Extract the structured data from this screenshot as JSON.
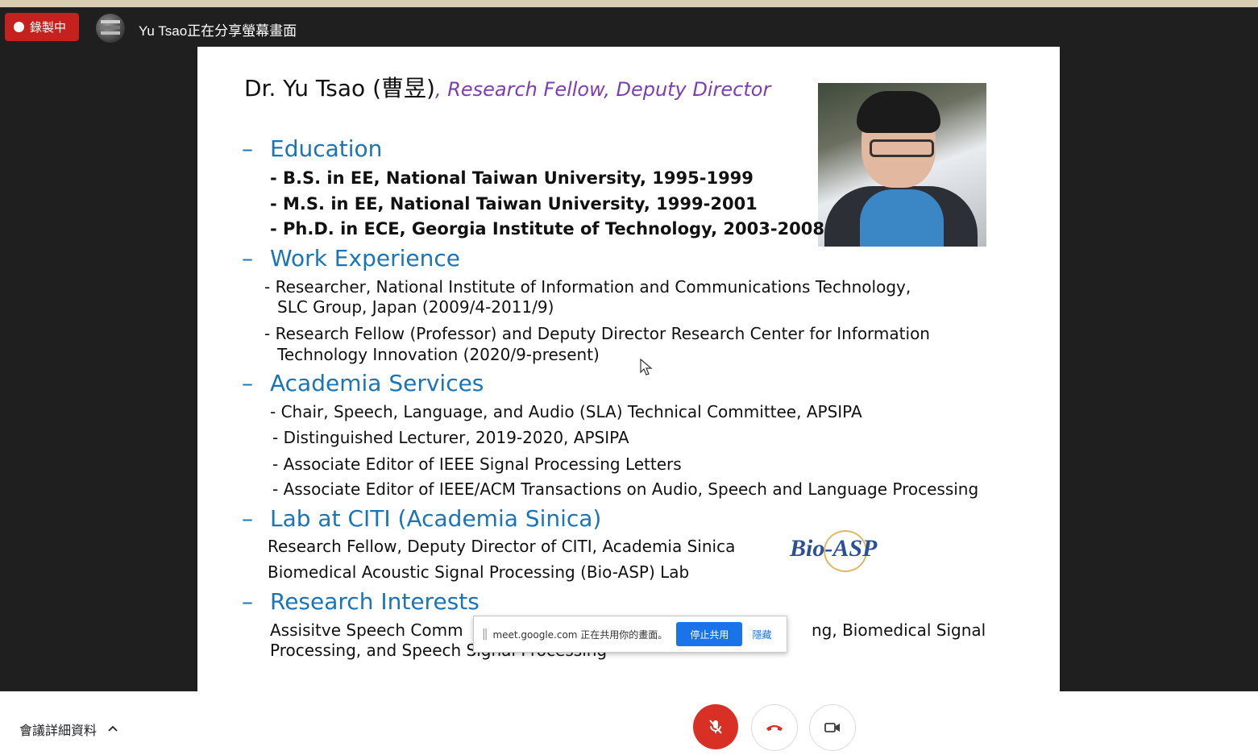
{
  "colors": {
    "recording": "#c5221f",
    "heading": "#1a74b8",
    "subtitle": "#7b3fb0",
    "stop_button": "#1a73e8",
    "mic_off": "#d93025"
  },
  "top_bar": {
    "recording_label": "錄製中",
    "presenter_text": "Yu Tsao正在分享螢幕畫面"
  },
  "slide": {
    "title": "Dr. Yu Tsao (曹昱)",
    "subtitle": ", Research Fellow, Deputy Director",
    "dash": "–",
    "education": {
      "heading": "Education",
      "items": [
        "- B.S.   in EE, National Taiwan University, 1995-1999",
        "- M.S.  in EE, National Taiwan University, 1999-2001",
        "- Ph.D. in ECE, Georgia Institute of Technology, 2003-2008"
      ]
    },
    "work": {
      "heading": "Work Experience",
      "items": [
        "- Researcher, National Institute of Information and Communications Technology,",
        "SLC Group, Japan (2009/4-2011/9)",
        "- Research Fellow (Professor) and Deputy Director Research Center for Information",
        "Technology Innovation (2020/9-present)"
      ]
    },
    "academia": {
      "heading": "Academia Services",
      "items": [
        "- Chair, Speech, Language, and Audio (SLA) Technical Committee, APSIPA",
        "- Distinguished Lecturer, 2019-2020, APSIPA",
        "- Associate Editor of IEEE Signal Processing Letters",
        "- Associate Editor of IEEE/ACM Transactions on Audio, Speech and Language Processing"
      ]
    },
    "lab": {
      "heading": "Lab at CITI (Academia Sinica)",
      "items": [
        "Research Fellow, Deputy Director of CITI, Academia Sinica",
        "Biomedical Acoustic Signal Processing (Bio-ASP) Lab"
      ],
      "logo_text": "Bio-ASP"
    },
    "interests": {
      "heading": "Research Interests",
      "line1_left": "Assisitve Speech Comm",
      "line1_right": "ng, Biomedical Signal",
      "line2": "Processing, and Speech Signal Processing"
    }
  },
  "share_bar": {
    "text": "meet.google.com 正在共用你的畫面。",
    "stop_label": "停止共用",
    "hide_label": "隱藏"
  },
  "bottom_bar": {
    "details_label": "會議詳細資料"
  },
  "icons": {
    "chevron": "chevron-up-icon",
    "mic": "mic-off-icon",
    "hangup": "hang-up-icon",
    "camera": "camera-icon"
  }
}
